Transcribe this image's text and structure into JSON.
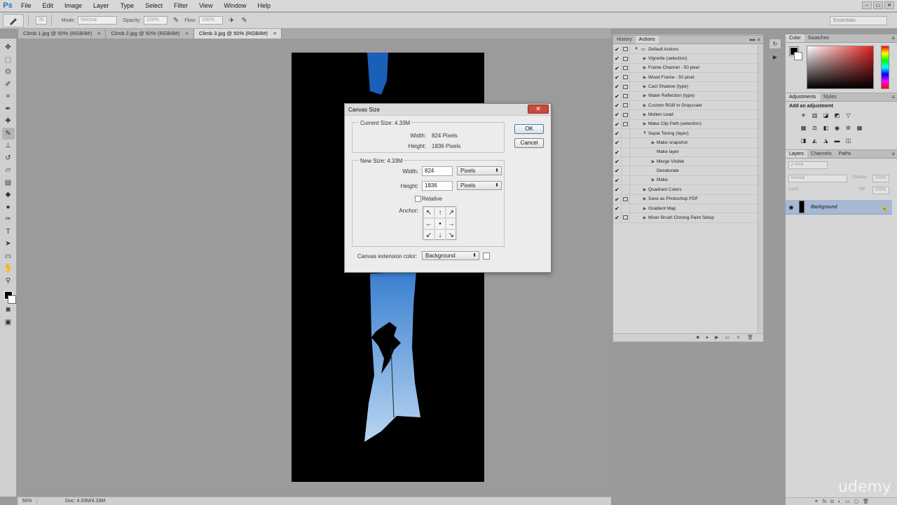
{
  "app": {
    "logo": "Ps"
  },
  "menu": [
    "File",
    "Edit",
    "Image",
    "Layer",
    "Type",
    "Select",
    "Filter",
    "View",
    "Window",
    "Help"
  ],
  "window_controls": [
    "–",
    "▭",
    "✕"
  ],
  "options_bar": {
    "brush_size": "35",
    "mode_label": "Mode:",
    "mode_value": "Normal",
    "opacity_label": "Opacity:",
    "opacity_value": "100%",
    "flow_label": "Flow:",
    "flow_value": "100%",
    "workspace": "Essentials"
  },
  "doc_tabs": [
    {
      "label": "Climb 1.jpg @ 50% (RGB/8#)",
      "close": "×"
    },
    {
      "label": "Climb 2.jpg @ 50% (RGB/8#)",
      "close": "×"
    },
    {
      "label": "Climb 3.jpg @ 50% (RGB/8#)",
      "close": "×",
      "active": true
    }
  ],
  "status_bar": {
    "zoom": "50%",
    "doc": "Doc: 4.33M/4.33M"
  },
  "dialog": {
    "title": "Canvas Size",
    "close": "✕",
    "current_size": {
      "title": "Current Size: 4.33M",
      "width_label": "Width:",
      "width_value": "824 Pixels",
      "height_label": "Height:",
      "height_value": "1836 Pixels"
    },
    "new_size": {
      "title": "New Size: 4.33M",
      "width_label": "Width:",
      "width_value": "824",
      "width_unit": "Pixels",
      "height_label": "Height:",
      "height_value": "1836",
      "height_unit": "Pixels",
      "relative_label": "Relative",
      "anchor_label": "Anchor:",
      "anchor_arrows": [
        "↖",
        "↑",
        "↗",
        "←",
        "•",
        "→",
        "↙",
        "↓",
        "↘"
      ]
    },
    "extension_label": "Canvas extension color:",
    "extension_value": "Background",
    "ok": "OK",
    "cancel": "Cancel"
  },
  "actions_panel": {
    "tabs": [
      "History",
      "Actions"
    ],
    "menu": "▸▸ ≡",
    "items": [
      {
        "label": "Default Actions",
        "level": 0,
        "expanded": true,
        "folder": true,
        "dlg": true
      },
      {
        "label": "Vignette (selection)",
        "level": 1,
        "dlg": true
      },
      {
        "label": "Frame Channel - 50 pixel",
        "level": 1,
        "dlg": true
      },
      {
        "label": "Wood Frame - 50 pixel",
        "level": 1,
        "dlg": true
      },
      {
        "label": "Cast Shadow (type)",
        "level": 1,
        "dlg": true
      },
      {
        "label": "Water Reflection (type)",
        "level": 1,
        "dlg": true
      },
      {
        "label": "Custom RGB to Grayscale",
        "level": 1,
        "dlg": true
      },
      {
        "label": "Molten Lead",
        "level": 1,
        "dlg": true
      },
      {
        "label": "Make Clip Path (selection)",
        "level": 1,
        "dlg": true
      },
      {
        "label": "Sepia Toning (layer)",
        "level": 1,
        "expanded": true
      },
      {
        "label": "Make snapshot",
        "level": 2
      },
      {
        "label": "Make layer",
        "level": 2,
        "leaf": true
      },
      {
        "label": "Merge Visible",
        "level": 2
      },
      {
        "label": "Desaturate",
        "level": 2,
        "leaf": true
      },
      {
        "label": "Make",
        "level": 2
      },
      {
        "label": "Quadrant Colors",
        "level": 1
      },
      {
        "label": "Save as Photoshop PDF",
        "level": 1,
        "dlg": true
      },
      {
        "label": "Gradient Map",
        "level": 1
      },
      {
        "label": "Mixer Brush Cloning Paint Setup",
        "level": 1,
        "dlg": true
      }
    ],
    "footer_icons": [
      "■",
      "●",
      "▶",
      "▭",
      "＋",
      "🗑"
    ]
  },
  "right_panels": {
    "color_tabs": [
      "Color",
      "Swatches"
    ],
    "adjustments_tabs": [
      "Adjustments",
      "Styles"
    ],
    "adjustments_title": "Add an adjustment",
    "layers_tabs": [
      "Layers",
      "Channels",
      "Paths"
    ],
    "kind_label": "ρ Kind",
    "blend_mode": "Normal",
    "opacity_label": "Opacity:",
    "opacity_value": "100%",
    "lock_label": "Lock:",
    "fill_label": "Fill:",
    "fill_value": "100%",
    "layer_name": "Background",
    "footer_icons": [
      "⚭",
      "fx",
      "◘",
      "◐",
      "▭",
      "▢",
      "🗑"
    ]
  },
  "watermark": "udemy",
  "colors": {
    "accent": "#3b7fc4",
    "close_red": "#c94a3c",
    "layer_selected": "#a6b8d4"
  }
}
